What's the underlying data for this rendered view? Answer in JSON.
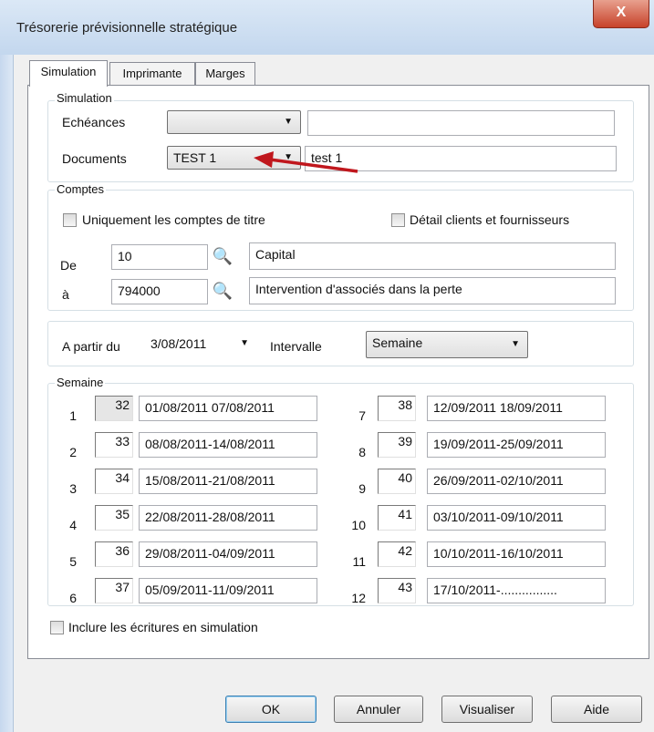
{
  "window": {
    "title": "Trésorerie prévisionnelle stratégique",
    "close_label": "X"
  },
  "tabs": [
    {
      "label": "Simulation",
      "active": true
    },
    {
      "label": "Imprimante",
      "active": false
    },
    {
      "label": "Marges",
      "active": false
    }
  ],
  "simulation": {
    "legend": "Simulation",
    "echeances_label": "Echéances",
    "echeances_value": "",
    "echeances_text": "",
    "documents_label": "Documents",
    "documents_value": "TEST 1",
    "documents_text": "test 1"
  },
  "comptes": {
    "legend": "Comptes",
    "only_title_accounts_label": "Uniquement les comptes de titre",
    "detail_label": "Détail clients et fournisseurs",
    "from_label": "De",
    "from_account": "10",
    "from_name": "Capital",
    "to_label": "à",
    "to_account": "794000",
    "to_name": "Intervention d'associés dans la perte"
  },
  "period": {
    "from_label": "A partir du",
    "from_date": "3/08/2011",
    "interval_label": "Intervalle",
    "interval_value": "Semaine"
  },
  "weeks": {
    "legend": "Semaine",
    "rows": [
      {
        "index": "1",
        "week": "32",
        "range": "01/08/2011 07/08/2011"
      },
      {
        "index": "2",
        "week": "33",
        "range": "08/08/2011-14/08/2011"
      },
      {
        "index": "3",
        "week": "34",
        "range": "15/08/2011-21/08/2011"
      },
      {
        "index": "4",
        "week": "35",
        "range": "22/08/2011-28/08/2011"
      },
      {
        "index": "5",
        "week": "36",
        "range": "29/08/2011-04/09/2011"
      },
      {
        "index": "6",
        "week": "37",
        "range": "05/09/2011-11/09/2011"
      },
      {
        "index": "7",
        "week": "38",
        "range": "12/09/2011 18/09/2011"
      },
      {
        "index": "8",
        "week": "39",
        "range": "19/09/2011-25/09/2011"
      },
      {
        "index": "9",
        "week": "40",
        "range": "26/09/2011-02/10/2011"
      },
      {
        "index": "10",
        "week": "41",
        "range": "03/10/2011-09/10/2011"
      },
      {
        "index": "11",
        "week": "42",
        "range": "10/10/2011-16/10/2011"
      },
      {
        "index": "12",
        "week": "43",
        "range": "17/10/2011-................"
      }
    ]
  },
  "include_label": "Inclure les écritures en simulation",
  "buttons": {
    "ok": "OK",
    "cancel": "Annuler",
    "view": "Visualiser",
    "help": "Aide"
  },
  "colors": {
    "arrow": "#c0171d",
    "titlebar": "#c3d7ee",
    "close": "#c7422a"
  }
}
